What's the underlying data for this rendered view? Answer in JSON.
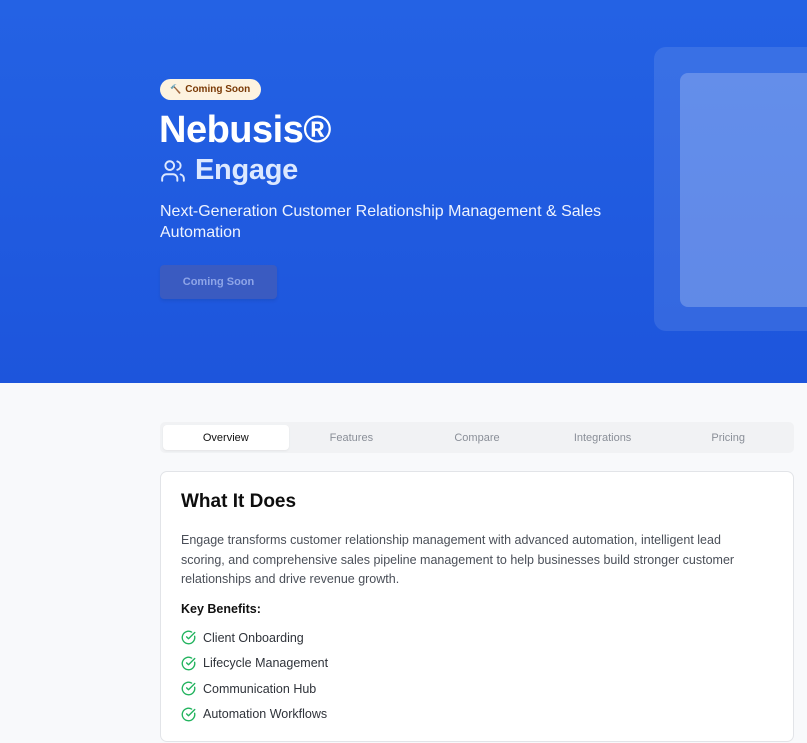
{
  "hero": {
    "badge_icon": "hammer-icon",
    "badge_label": "Coming Soon",
    "brand": "Nebusis®",
    "product_icon": "users-icon",
    "product_name": "Engage",
    "tagline": "Next-Generation Customer Relationship Management & Sales Automation",
    "cta_label": "Coming Soon"
  },
  "tabs": [
    {
      "label": "Overview",
      "active": true
    },
    {
      "label": "Features",
      "active": false
    },
    {
      "label": "Compare",
      "active": false
    },
    {
      "label": "Integrations",
      "active": false
    },
    {
      "label": "Pricing",
      "active": false
    }
  ],
  "overview": {
    "title": "What It Does",
    "description": "Engage transforms customer relationship management with advanced automation, intelligent lead scoring, and comprehensive sales pipeline management to help businesses build stronger customer relationships and drive revenue growth.",
    "benefits_label": "Key Benefits:",
    "benefit_icon": "check-circle-icon",
    "benefits": [
      "Client Onboarding",
      "Lifecycle Management",
      "Communication Hub",
      "Automation Workflows"
    ]
  },
  "colors": {
    "hero_bg": "#2462e4",
    "badge_bg": "#fdf3e0",
    "check_green": "#22b35e"
  }
}
